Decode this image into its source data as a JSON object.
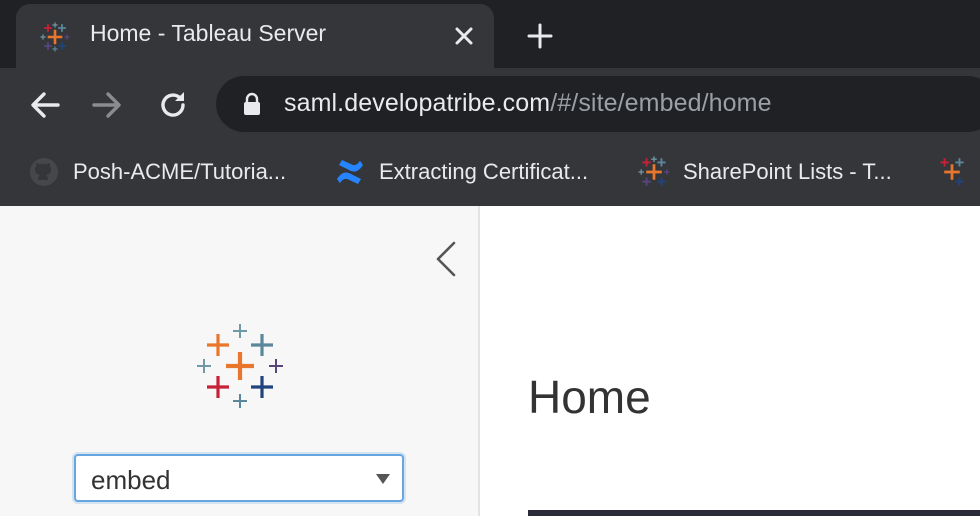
{
  "browser": {
    "tab": {
      "title": "Home - Tableau Server",
      "favicon": "tableau-icon"
    },
    "new_tab_icon": "plus-icon",
    "toolbar": {
      "back_icon": "arrow-left-icon",
      "forward_icon": "arrow-right-icon",
      "reload_icon": "reload-icon",
      "url_host": "saml.developatribe.com",
      "url_path": "/#/site/embed/home",
      "secure_icon": "lock-icon"
    },
    "bookmarks": [
      {
        "label": "Posh-ACME/Tutoria...",
        "icon": "github-icon"
      },
      {
        "label": "Extracting Certificat...",
        "icon": "confluence-icon"
      },
      {
        "label": "SharePoint Lists - T...",
        "icon": "tableau-icon"
      },
      {
        "label": "",
        "icon": "tableau-icon"
      }
    ]
  },
  "sidebar": {
    "collapse_icon": "chevron-left-icon",
    "logo": "tableau-logo",
    "site_select": {
      "value": "embed"
    }
  },
  "main": {
    "title": "Home"
  },
  "colors": {
    "tab_strip": "#202124",
    "toolbar": "#35363a",
    "omnibox": "#202124",
    "sidebar_bg": "#f7f7f7",
    "select_border": "#67a6e0",
    "tableau_orange": "#e8762d",
    "tableau_red": "#c72037",
    "tableau_navy": "#1f447e",
    "tableau_blue": "#5b879b",
    "tableau_lightblue": "#7099a6",
    "tableau_purple": "#59457e"
  }
}
